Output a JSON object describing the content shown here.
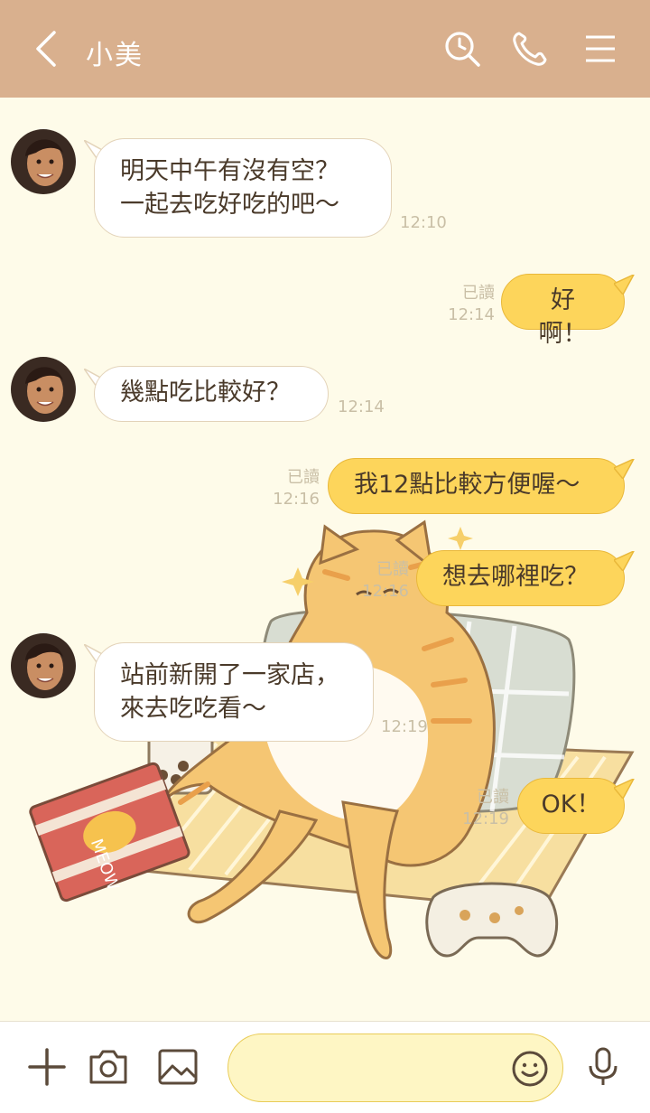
{
  "header": {
    "title": "小美",
    "background": "#D9B08E",
    "icons": [
      "back-icon",
      "search-icon",
      "phone-icon",
      "menu-icon"
    ]
  },
  "messages": [
    {
      "side": "in",
      "lines": [
        "明天中午有沒有空？",
        "一起去吃好吃的吧～"
      ],
      "time": "12:10"
    },
    {
      "side": "out",
      "lines": [
        "好啊！"
      ],
      "read": "已讀",
      "time": "12:14"
    },
    {
      "side": "in",
      "lines": [
        "幾點吃比較好？"
      ],
      "time": "12:14"
    },
    {
      "side": "out",
      "lines": [
        "我12點比較方便喔～"
      ],
      "read": "已讀",
      "time": "12:16"
    },
    {
      "side": "out",
      "lines": [
        "想去哪裡吃？"
      ],
      "read": "已讀",
      "time": "12:16"
    },
    {
      "side": "in",
      "lines": [
        "站前新開了一家店，",
        "來去吃吃看～"
      ],
      "time": "12:19"
    },
    {
      "side": "out",
      "lines": [
        "OK！"
      ],
      "read": "已讀",
      "time": "12:19"
    }
  ],
  "illustration": {
    "description_name": "cat-lounging-illustration",
    "snack_bag_text": "MEOW"
  },
  "input": {
    "value": "",
    "placeholder": ""
  },
  "colors": {
    "background": "#FEFBE9",
    "outgoing_bubble": "#FDD55B",
    "incoming_bubble": "#FFFFFF",
    "accent": "#D9B08E"
  }
}
